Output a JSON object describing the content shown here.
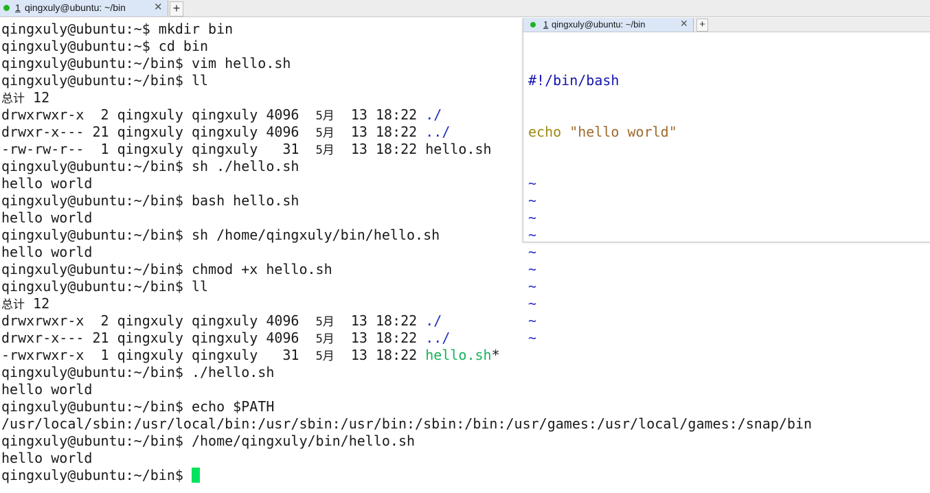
{
  "main_window": {
    "tab": {
      "number": "1",
      "title": "qingxuly@ubuntu: ~/bin",
      "close": "✕"
    },
    "new_tab": "+",
    "lines": [
      [
        {
          "t": "qingxuly@ubuntu:~$ mkdir bin"
        }
      ],
      [
        {
          "t": "qingxuly@ubuntu:~$ cd bin"
        }
      ],
      [
        {
          "t": "qingxuly@ubuntu:~/bin$ vim hello.sh"
        }
      ],
      [
        {
          "t": "qingxuly@ubuntu:~/bin$ ll"
        }
      ],
      [
        {
          "t": "总计",
          "c": "cjk"
        },
        {
          "t": " 12"
        }
      ],
      [
        {
          "t": "drwxrwxr-x  2 qingxuly qingxuly 4096  "
        },
        {
          "t": "5月",
          "c": "cjk"
        },
        {
          "t": "  13 18:22 "
        },
        {
          "t": "./",
          "c": "dir"
        }
      ],
      [
        {
          "t": "drwxr-x--- 21 qingxuly qingxuly 4096  "
        },
        {
          "t": "5月",
          "c": "cjk"
        },
        {
          "t": "  13 18:22 "
        },
        {
          "t": "../",
          "c": "dir"
        }
      ],
      [
        {
          "t": "-rw-rw-r--  1 qingxuly qingxuly   31  "
        },
        {
          "t": "5月",
          "c": "cjk"
        },
        {
          "t": "  13 18:22 hello.sh"
        }
      ],
      [
        {
          "t": "qingxuly@ubuntu:~/bin$ sh ./hello.sh"
        }
      ],
      [
        {
          "t": "hello world"
        }
      ],
      [
        {
          "t": "qingxuly@ubuntu:~/bin$ bash hello.sh"
        }
      ],
      [
        {
          "t": "hello world"
        }
      ],
      [
        {
          "t": "qingxuly@ubuntu:~/bin$ sh /home/qingxuly/bin/hello.sh"
        }
      ],
      [
        {
          "t": "hello world"
        }
      ],
      [
        {
          "t": "qingxuly@ubuntu:~/bin$ chmod +x hello.sh"
        }
      ],
      [
        {
          "t": "qingxuly@ubuntu:~/bin$ ll"
        }
      ],
      [
        {
          "t": "总计",
          "c": "cjk"
        },
        {
          "t": " 12"
        }
      ],
      [
        {
          "t": "drwxrwxr-x  2 qingxuly qingxuly 4096  "
        },
        {
          "t": "5月",
          "c": "cjk"
        },
        {
          "t": "  13 18:22 "
        },
        {
          "t": "./",
          "c": "dir"
        }
      ],
      [
        {
          "t": "drwxr-x--- 21 qingxuly qingxuly 4096  "
        },
        {
          "t": "5月",
          "c": "cjk"
        },
        {
          "t": "  13 18:22 "
        },
        {
          "t": "../",
          "c": "dir"
        }
      ],
      [
        {
          "t": "-rwxrwxr-x  1 qingxuly qingxuly   31  "
        },
        {
          "t": "5月",
          "c": "cjk"
        },
        {
          "t": "  13 18:22 "
        },
        {
          "t": "hello.sh",
          "c": "exec"
        },
        {
          "t": "*"
        }
      ],
      [
        {
          "t": "qingxuly@ubuntu:~/bin$ ./hello.sh"
        }
      ],
      [
        {
          "t": "hello world"
        }
      ],
      [
        {
          "t": "qingxuly@ubuntu:~/bin$ echo $PATH"
        }
      ],
      [
        {
          "t": "/usr/local/sbin:/usr/local/bin:/usr/sbin:/usr/bin:/sbin:/bin:/usr/games:/usr/local/games:/snap/bin"
        }
      ],
      [
        {
          "t": "qingxuly@ubuntu:~/bin$ /home/qingxuly/bin/hello.sh"
        }
      ],
      [
        {
          "t": "hello world"
        }
      ]
    ],
    "prompt": "qingxuly@ubuntu:~/bin$ "
  },
  "vim_window": {
    "tab": {
      "number": "1",
      "title": "qingxuly@ubuntu: ~/bin",
      "close": "✕"
    },
    "new_tab": "+",
    "shebang": "#!/bin/bash",
    "keyword": "echo",
    "string": "\"hello world\"",
    "tilde_lines": [
      "~",
      "~",
      "~",
      "~",
      "~",
      "~",
      "~",
      "~",
      "~",
      "~"
    ]
  },
  "colors": {
    "directory": "#1e2ebd",
    "executable": "#17b25a",
    "cursor": "#00e35c",
    "status_dot": "#1fb31f"
  }
}
